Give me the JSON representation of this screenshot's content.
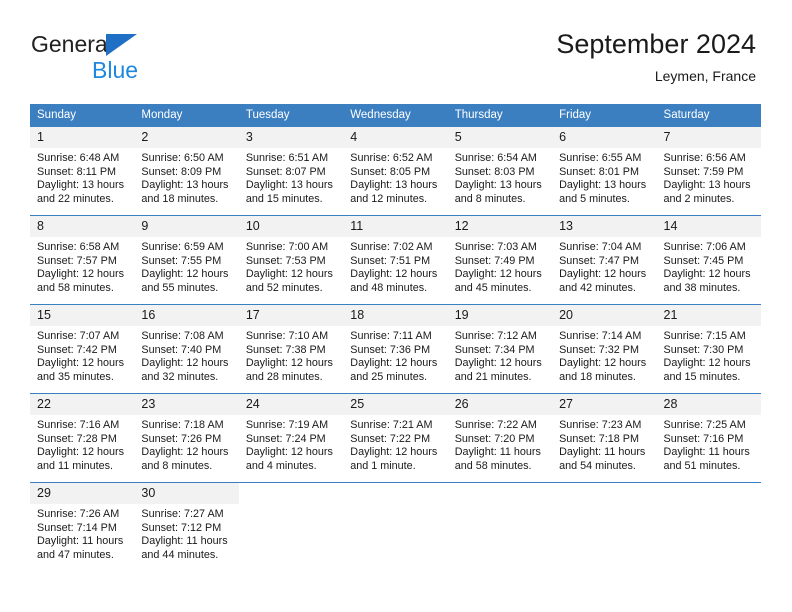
{
  "brand": {
    "name_part1": "General",
    "name_part2": "Blue",
    "triangle_color": "#1f6fc4",
    "blue_color": "#1f87de"
  },
  "header": {
    "title": "September 2024",
    "subtitle": "Leymen, France"
  },
  "theme": {
    "header_blue": "#3c7fc1",
    "daynum_bg": "#f2f2f2",
    "text": "#1a1a1a"
  },
  "calendar": {
    "weekday_headers": [
      "Sunday",
      "Monday",
      "Tuesday",
      "Wednesday",
      "Thursday",
      "Friday",
      "Saturday"
    ],
    "weeks": [
      [
        {
          "day": "1",
          "sunrise": "Sunrise: 6:48 AM",
          "sunset": "Sunset: 8:11 PM",
          "daylight1": "Daylight: 13 hours",
          "daylight2": "and 22 minutes."
        },
        {
          "day": "2",
          "sunrise": "Sunrise: 6:50 AM",
          "sunset": "Sunset: 8:09 PM",
          "daylight1": "Daylight: 13 hours",
          "daylight2": "and 18 minutes."
        },
        {
          "day": "3",
          "sunrise": "Sunrise: 6:51 AM",
          "sunset": "Sunset: 8:07 PM",
          "daylight1": "Daylight: 13 hours",
          "daylight2": "and 15 minutes."
        },
        {
          "day": "4",
          "sunrise": "Sunrise: 6:52 AM",
          "sunset": "Sunset: 8:05 PM",
          "daylight1": "Daylight: 13 hours",
          "daylight2": "and 12 minutes."
        },
        {
          "day": "5",
          "sunrise": "Sunrise: 6:54 AM",
          "sunset": "Sunset: 8:03 PM",
          "daylight1": "Daylight: 13 hours",
          "daylight2": "and 8 minutes."
        },
        {
          "day": "6",
          "sunrise": "Sunrise: 6:55 AM",
          "sunset": "Sunset: 8:01 PM",
          "daylight1": "Daylight: 13 hours",
          "daylight2": "and 5 minutes."
        },
        {
          "day": "7",
          "sunrise": "Sunrise: 6:56 AM",
          "sunset": "Sunset: 7:59 PM",
          "daylight1": "Daylight: 13 hours",
          "daylight2": "and 2 minutes."
        }
      ],
      [
        {
          "day": "8",
          "sunrise": "Sunrise: 6:58 AM",
          "sunset": "Sunset: 7:57 PM",
          "daylight1": "Daylight: 12 hours",
          "daylight2": "and 58 minutes."
        },
        {
          "day": "9",
          "sunrise": "Sunrise: 6:59 AM",
          "sunset": "Sunset: 7:55 PM",
          "daylight1": "Daylight: 12 hours",
          "daylight2": "and 55 minutes."
        },
        {
          "day": "10",
          "sunrise": "Sunrise: 7:00 AM",
          "sunset": "Sunset: 7:53 PM",
          "daylight1": "Daylight: 12 hours",
          "daylight2": "and 52 minutes."
        },
        {
          "day": "11",
          "sunrise": "Sunrise: 7:02 AM",
          "sunset": "Sunset: 7:51 PM",
          "daylight1": "Daylight: 12 hours",
          "daylight2": "and 48 minutes."
        },
        {
          "day": "12",
          "sunrise": "Sunrise: 7:03 AM",
          "sunset": "Sunset: 7:49 PM",
          "daylight1": "Daylight: 12 hours",
          "daylight2": "and 45 minutes."
        },
        {
          "day": "13",
          "sunrise": "Sunrise: 7:04 AM",
          "sunset": "Sunset: 7:47 PM",
          "daylight1": "Daylight: 12 hours",
          "daylight2": "and 42 minutes."
        },
        {
          "day": "14",
          "sunrise": "Sunrise: 7:06 AM",
          "sunset": "Sunset: 7:45 PM",
          "daylight1": "Daylight: 12 hours",
          "daylight2": "and 38 minutes."
        }
      ],
      [
        {
          "day": "15",
          "sunrise": "Sunrise: 7:07 AM",
          "sunset": "Sunset: 7:42 PM",
          "daylight1": "Daylight: 12 hours",
          "daylight2": "and 35 minutes."
        },
        {
          "day": "16",
          "sunrise": "Sunrise: 7:08 AM",
          "sunset": "Sunset: 7:40 PM",
          "daylight1": "Daylight: 12 hours",
          "daylight2": "and 32 minutes."
        },
        {
          "day": "17",
          "sunrise": "Sunrise: 7:10 AM",
          "sunset": "Sunset: 7:38 PM",
          "daylight1": "Daylight: 12 hours",
          "daylight2": "and 28 minutes."
        },
        {
          "day": "18",
          "sunrise": "Sunrise: 7:11 AM",
          "sunset": "Sunset: 7:36 PM",
          "daylight1": "Daylight: 12 hours",
          "daylight2": "and 25 minutes."
        },
        {
          "day": "19",
          "sunrise": "Sunrise: 7:12 AM",
          "sunset": "Sunset: 7:34 PM",
          "daylight1": "Daylight: 12 hours",
          "daylight2": "and 21 minutes."
        },
        {
          "day": "20",
          "sunrise": "Sunrise: 7:14 AM",
          "sunset": "Sunset: 7:32 PM",
          "daylight1": "Daylight: 12 hours",
          "daylight2": "and 18 minutes."
        },
        {
          "day": "21",
          "sunrise": "Sunrise: 7:15 AM",
          "sunset": "Sunset: 7:30 PM",
          "daylight1": "Daylight: 12 hours",
          "daylight2": "and 15 minutes."
        }
      ],
      [
        {
          "day": "22",
          "sunrise": "Sunrise: 7:16 AM",
          "sunset": "Sunset: 7:28 PM",
          "daylight1": "Daylight: 12 hours",
          "daylight2": "and 11 minutes."
        },
        {
          "day": "23",
          "sunrise": "Sunrise: 7:18 AM",
          "sunset": "Sunset: 7:26 PM",
          "daylight1": "Daylight: 12 hours",
          "daylight2": "and 8 minutes."
        },
        {
          "day": "24",
          "sunrise": "Sunrise: 7:19 AM",
          "sunset": "Sunset: 7:24 PM",
          "daylight1": "Daylight: 12 hours",
          "daylight2": "and 4 minutes."
        },
        {
          "day": "25",
          "sunrise": "Sunrise: 7:21 AM",
          "sunset": "Sunset: 7:22 PM",
          "daylight1": "Daylight: 12 hours",
          "daylight2": "and 1 minute."
        },
        {
          "day": "26",
          "sunrise": "Sunrise: 7:22 AM",
          "sunset": "Sunset: 7:20 PM",
          "daylight1": "Daylight: 11 hours",
          "daylight2": "and 58 minutes."
        },
        {
          "day": "27",
          "sunrise": "Sunrise: 7:23 AM",
          "sunset": "Sunset: 7:18 PM",
          "daylight1": "Daylight: 11 hours",
          "daylight2": "and 54 minutes."
        },
        {
          "day": "28",
          "sunrise": "Sunrise: 7:25 AM",
          "sunset": "Sunset: 7:16 PM",
          "daylight1": "Daylight: 11 hours",
          "daylight2": "and 51 minutes."
        }
      ],
      [
        {
          "day": "29",
          "sunrise": "Sunrise: 7:26 AM",
          "sunset": "Sunset: 7:14 PM",
          "daylight1": "Daylight: 11 hours",
          "daylight2": "and 47 minutes."
        },
        {
          "day": "30",
          "sunrise": "Sunrise: 7:27 AM",
          "sunset": "Sunset: 7:12 PM",
          "daylight1": "Daylight: 11 hours",
          "daylight2": "and 44 minutes."
        },
        {
          "day": "",
          "sunrise": "",
          "sunset": "",
          "daylight1": "",
          "daylight2": ""
        },
        {
          "day": "",
          "sunrise": "",
          "sunset": "",
          "daylight1": "",
          "daylight2": ""
        },
        {
          "day": "",
          "sunrise": "",
          "sunset": "",
          "daylight1": "",
          "daylight2": ""
        },
        {
          "day": "",
          "sunrise": "",
          "sunset": "",
          "daylight1": "",
          "daylight2": ""
        },
        {
          "day": "",
          "sunrise": "",
          "sunset": "",
          "daylight1": "",
          "daylight2": ""
        }
      ]
    ]
  }
}
